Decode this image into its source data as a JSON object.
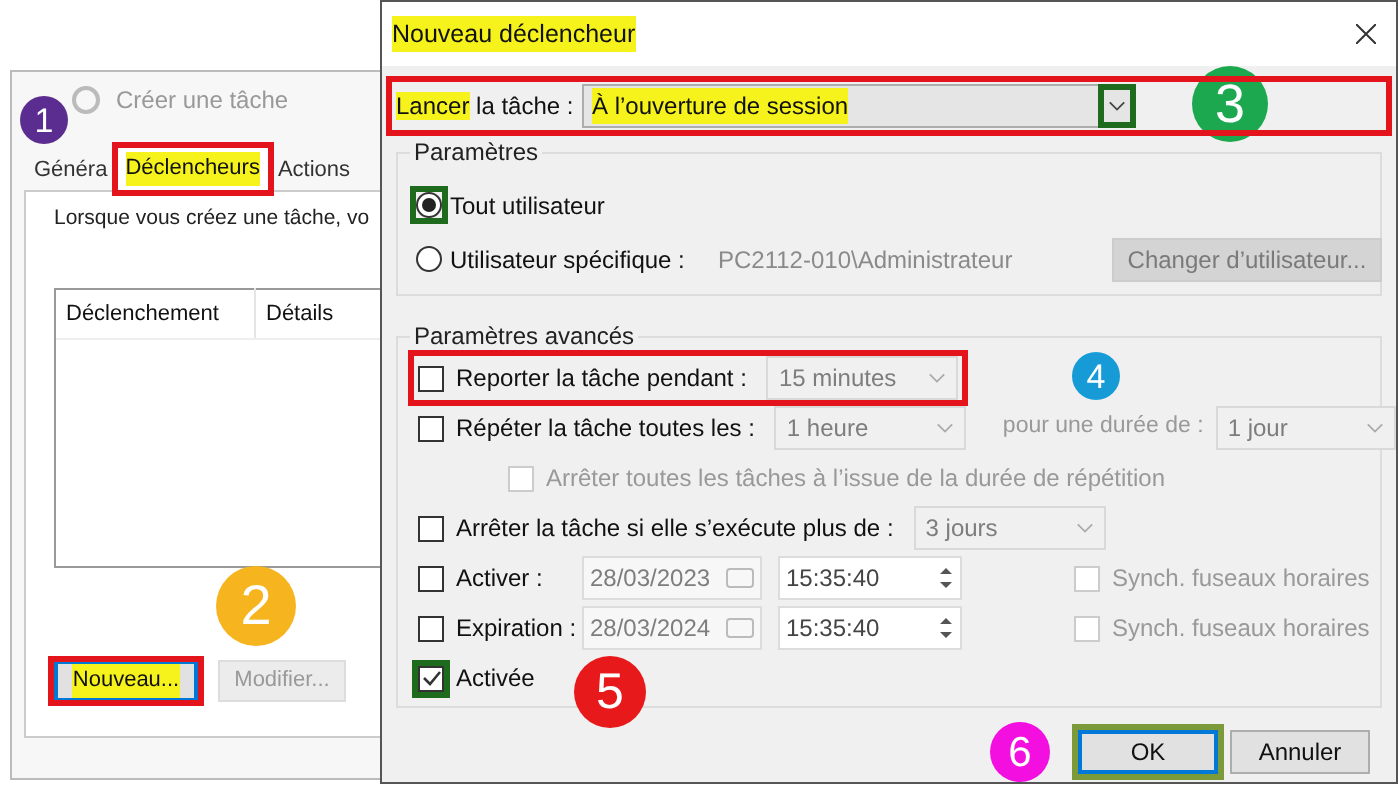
{
  "background_window": {
    "title": "Créer une tâche",
    "tabs": [
      {
        "label": "Généra",
        "selected": false,
        "highlighted": false
      },
      {
        "label": "Déclencheurs",
        "selected": true,
        "highlighted": true
      },
      {
        "label": "Actions",
        "selected": false,
        "highlighted": false
      }
    ],
    "description": "Lorsque vous créez une tâche, vo",
    "list_columns": [
      "Déclenchement",
      "Détails"
    ],
    "buttons": [
      {
        "label": "Nouveau...",
        "disabled": false,
        "highlighted": true
      },
      {
        "label": "Modifier...",
        "disabled": true,
        "highlighted": false
      }
    ]
  },
  "dialog": {
    "title": "Nouveau déclencheur",
    "title_highlighted": true,
    "start": {
      "label_highlighted": "Lancer",
      "label_rest": "la tâche :",
      "value": "À l’ouverture de session",
      "value_highlighted": true
    },
    "settings": {
      "title": "Paramètres",
      "options": [
        {
          "label": "Tout utilisateur",
          "selected": true
        },
        {
          "label": "Utilisateur spécifique :",
          "selected": false
        }
      ],
      "user": "PC2112-010\\Administrateur",
      "change_button": {
        "label": "Changer d’utilisateur...",
        "disabled": true
      }
    },
    "advanced": {
      "title": "Paramètres avancés",
      "rows": [
        {
          "kind": "select",
          "label": "Reporter la tâche pendant :",
          "checked": false,
          "value": "15 minutes"
        },
        {
          "kind": "repeat",
          "label": "Répéter la tâche toutes les :",
          "checked": false,
          "value": "1 heure",
          "duration_label": "pour une durée de :",
          "duration": "1 jour"
        },
        {
          "kind": "sub",
          "label": "Arrêter toutes les tâches à l’issue de la durée de répétition",
          "checked": false,
          "disabled": true
        },
        {
          "kind": "select",
          "label": "Arrêter la tâche si elle s’exécute plus de :",
          "checked": false,
          "value": "3 jours"
        },
        {
          "kind": "datetime",
          "label": "Activer :",
          "checked": false,
          "date": "28/03/2023",
          "time": "15:35:40",
          "sync_label": "Synch. fuseaux horaires",
          "sync_checked": false
        },
        {
          "kind": "datetime",
          "label": "Expiration :",
          "checked": false,
          "date": "28/03/2024",
          "time": "15:35:40",
          "sync_label": "Synch. fuseaux horaires",
          "sync_checked": false
        },
        {
          "kind": "check",
          "label": "Activée",
          "checked": true
        }
      ]
    },
    "buttons": [
      {
        "label": "OK",
        "default": true
      },
      {
        "label": "Annuler",
        "default": false
      }
    ]
  },
  "annotations": {
    "markers": [
      {
        "number": "1",
        "color": "#5c2d91"
      },
      {
        "number": "2",
        "color": "#f6b41f"
      },
      {
        "number": "3",
        "color": "#1ba84f"
      },
      {
        "number": "4",
        "color": "#179bd7"
      },
      {
        "number": "5",
        "color": "#e8191a"
      },
      {
        "number": "6",
        "color": "#f20fe0"
      }
    ],
    "frames": [
      {
        "color": "#e3141b"
      },
      {
        "color": "#e3141b"
      },
      {
        "color": "#e3141b"
      },
      {
        "color": "#e3141b"
      },
      {
        "color": "#1e6b1e"
      },
      {
        "color": "#1e6b1e"
      },
      {
        "color": "#1e6b1e"
      },
      {
        "color": "#7c9a3a"
      }
    ]
  }
}
